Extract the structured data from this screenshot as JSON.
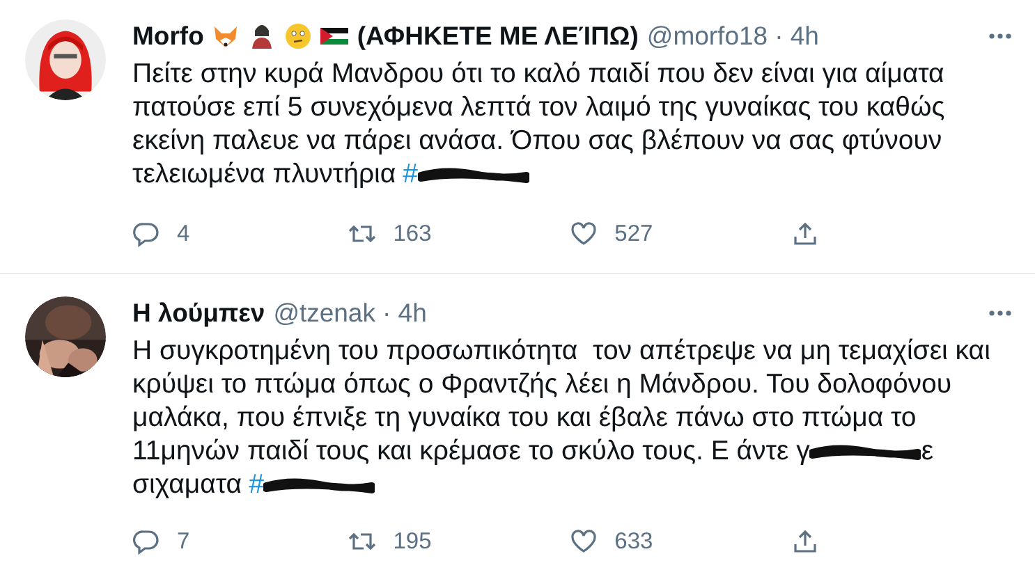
{
  "tweets": [
    {
      "avatar": {
        "kind": "cartoon"
      },
      "name": "Morfo",
      "badges": [
        {
          "kind": "fox"
        },
        {
          "kind": "person"
        },
        {
          "kind": "face"
        },
        {
          "kind": "flag"
        }
      ],
      "name_suffix": "(ΑΦΗΚΕΤΕ ΜΕ ΛΕΊΠΩ)",
      "handle": "@morfo18",
      "time": "· 4h",
      "body": [
        {
          "kind": "text",
          "text": "Πείτε στην κυρά Μανδρου ότι το καλό παιδί που δεν είναι για αίματα"
        },
        {
          "kind": "break"
        },
        {
          "kind": "text",
          "text": "πατούσε επί 5 συνεχόμενα λεπτά τον λαιμό της γυναίκας του καθώς"
        },
        {
          "kind": "break"
        },
        {
          "kind": "text",
          "text": "εκείνη παλευε να πάρει ανάσα. Όπου σας βλέπουν να σας φτύνουν"
        },
        {
          "kind": "break"
        },
        {
          "kind": "text",
          "text": "τελειωμένα πλυντήρια"
        },
        {
          "kind": "hashtag",
          "text": "#"
        },
        {
          "kind": "redaction"
        }
      ],
      "replies": "4",
      "retweets": "163",
      "likes": "527"
    },
    {
      "name": "Η λούμπεν",
      "handle": "@tzenak",
      "time": "· 4h",
      "body": [
        {
          "kind": "text",
          "text": "Η συγκροτημένη του προσωπικότητα  τον απέτρεψε να μη τεμαχίσει και"
        },
        {
          "kind": "break"
        },
        {
          "kind": "text",
          "text": "κρύψει το πτώμα όπως ο Φραντζής λέει η Μάνδρου. Του δολοφόνου"
        },
        {
          "kind": "break"
        },
        {
          "kind": "text",
          "text": "μαλάκα, που έπνιξε τη γυναίκα του και έβαλε πάνω στο πτώμα το"
        },
        {
          "kind": "break"
        },
        {
          "kind": "text",
          "text": "11μηνών παιδί τους και κρέμασε το σκύλο τους. Ε άντε γ"
        },
        {
          "kind": "redaction"
        },
        {
          "kind": "text",
          "text": "ε"
        },
        {
          "kind": "break"
        },
        {
          "kind": "text",
          "text": "σιχαματα"
        },
        {
          "kind": "hashtag",
          "text": "#"
        },
        {
          "kind": "redaction"
        }
      ],
      "replies": "7",
      "retweets": "195",
      "likes": "633"
    }
  ]
}
